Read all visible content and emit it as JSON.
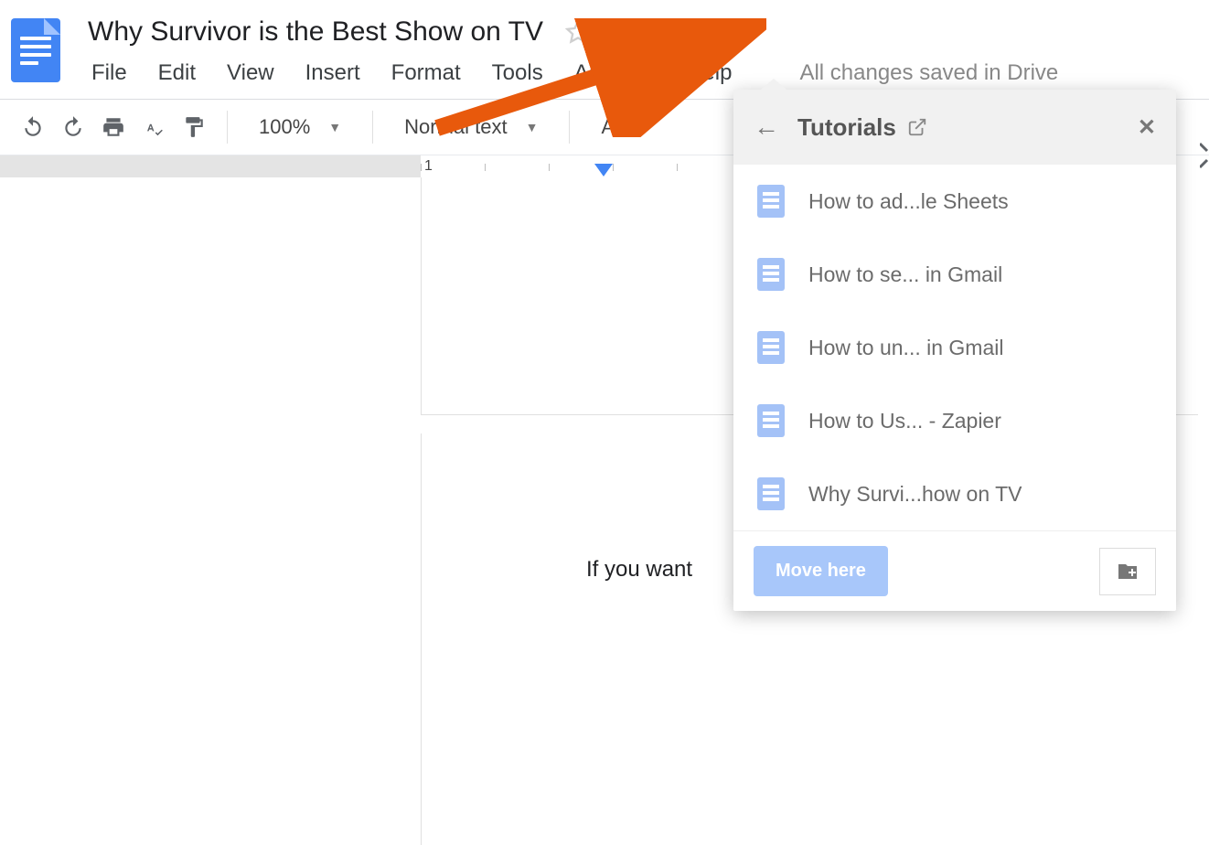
{
  "document": {
    "title": "Why Survivor is the Best Show on TV",
    "body_preview": "If you want",
    "save_status": "All changes saved in Drive"
  },
  "menubar": {
    "items": [
      "File",
      "Edit",
      "View",
      "Insert",
      "Format",
      "Tools",
      "Add-ons",
      "Help"
    ]
  },
  "toolbar": {
    "zoom": "100%",
    "paragraph_style": "Normal text",
    "font": "Arial"
  },
  "ruler": {
    "label": "1"
  },
  "move_panel": {
    "folder_name": "Tutorials",
    "files": [
      "How to ad...le Sheets",
      "How to se... in Gmail",
      "How to un... in Gmail",
      "How to Us... - Zapier",
      "Why Survi...how on TV"
    ],
    "move_button": "Move here"
  }
}
